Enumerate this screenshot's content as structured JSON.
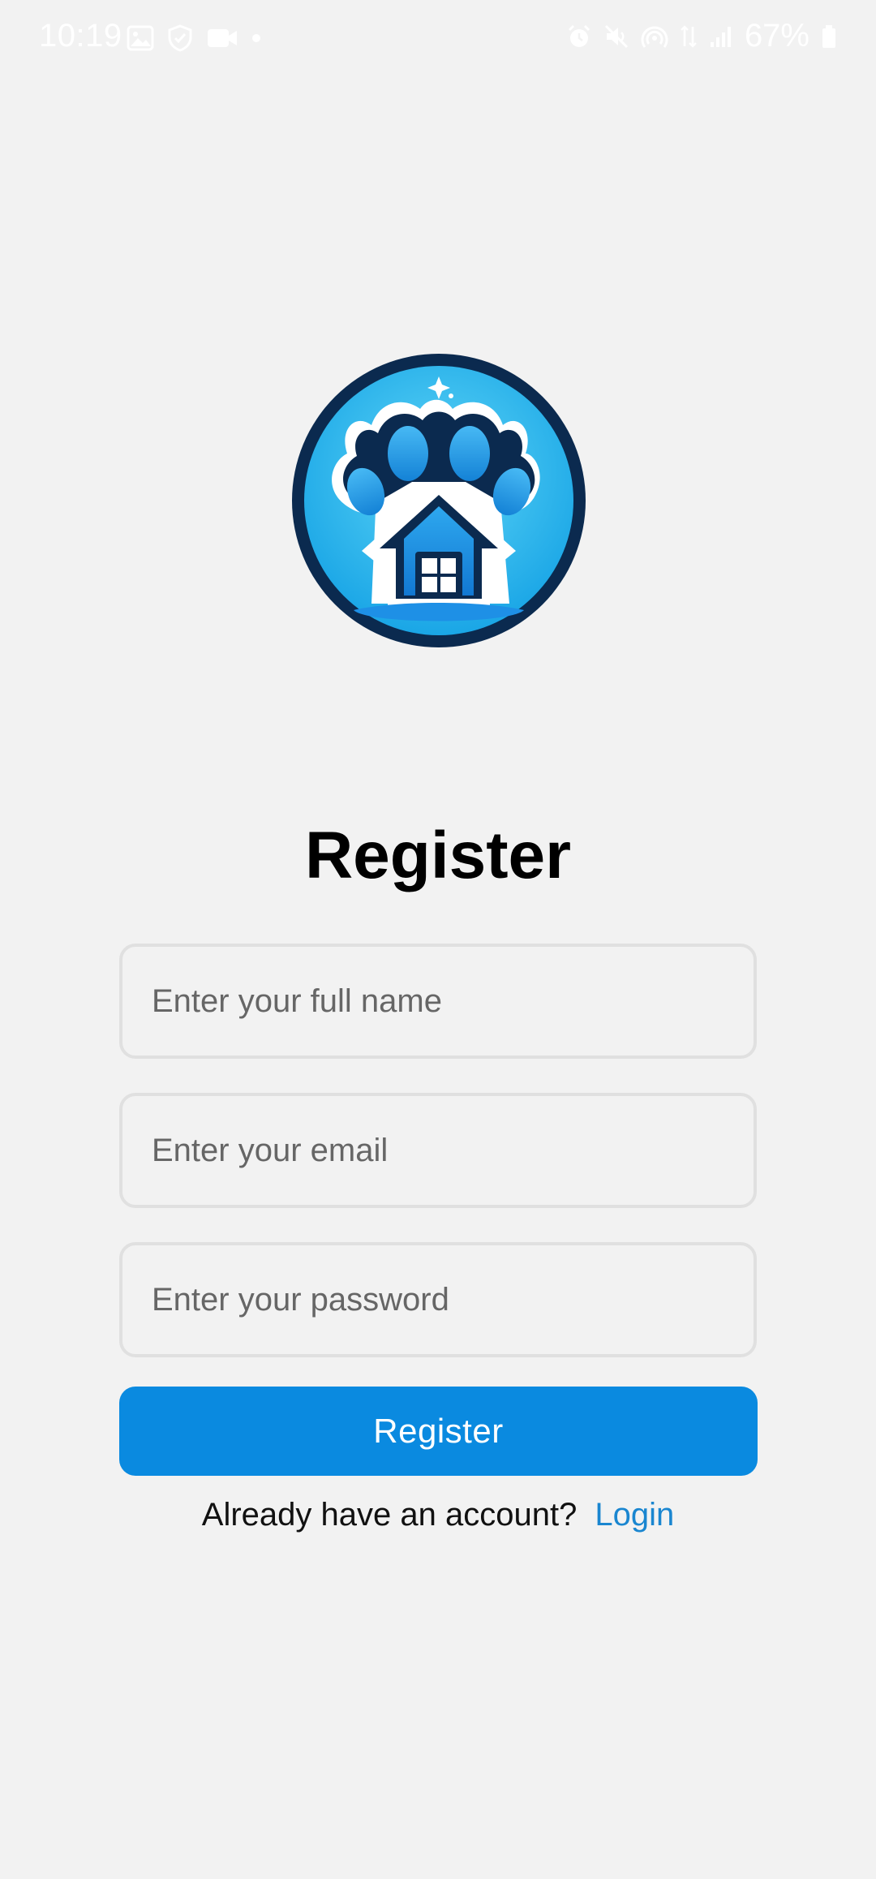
{
  "status_bar": {
    "time": "10:19",
    "battery": "67%",
    "left_icons": [
      "image-icon",
      "shield-icon",
      "video-icon",
      "dot-icon"
    ],
    "right_icons": [
      "alarm-icon",
      "mute-icon",
      "hotspot-icon",
      "data-icon",
      "signal-icon",
      "battery-icon"
    ]
  },
  "logo": {
    "icon": "paw-house-logo"
  },
  "form": {
    "title": "Register",
    "name_placeholder": "Enter your full name",
    "email_placeholder": "Enter your email",
    "password_placeholder": "Enter your password",
    "submit_label": "Register"
  },
  "footer": {
    "prompt": "Already have an account?",
    "login_label": "Login"
  },
  "colors": {
    "background": "#f2f2f2",
    "primary": "#0a8ae0",
    "link": "#1a86d0",
    "logo_dark": "#0b2a4f",
    "logo_light": "#34c6f2"
  }
}
